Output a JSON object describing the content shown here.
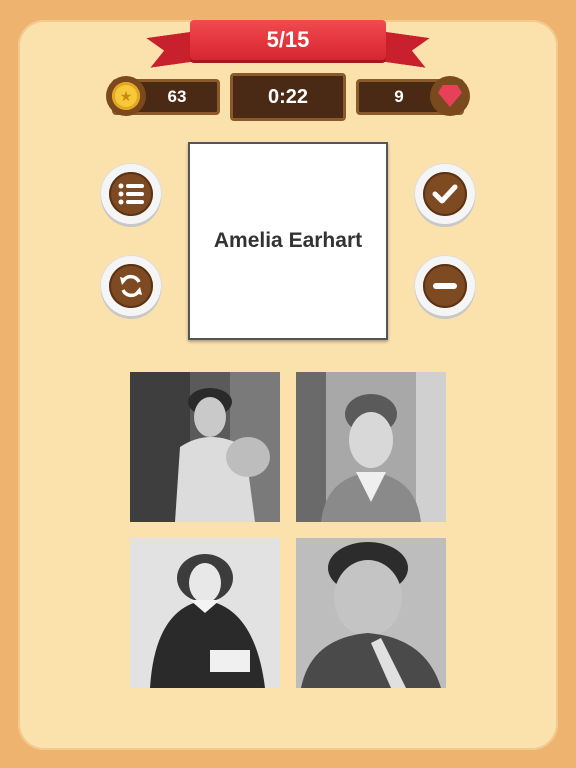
{
  "progress": {
    "label": "5/15",
    "current": 5,
    "total": 15
  },
  "stats": {
    "coins": "63",
    "timer": "0:22",
    "gems": "9"
  },
  "word_card": {
    "name": "Amelia Earhart"
  },
  "buttons": {
    "menu_icon": "list-icon",
    "restart_icon": "refresh-icon",
    "confirm_icon": "checkmark-icon",
    "skip_icon": "minus-icon"
  },
  "choices": [
    {
      "id": "photo-1",
      "kind": "portrait-woman-lace-dress"
    },
    {
      "id": "photo-2",
      "kind": "portrait-woman-aviator"
    },
    {
      "id": "photo-3",
      "kind": "portrait-woman-seated-engraving"
    },
    {
      "id": "photo-4",
      "kind": "portrait-woman-sash"
    }
  ],
  "colors": {
    "background": "#eeb36f",
    "panel": "#fbe2ad",
    "ribbon": "#d7262f",
    "wood": "#7d4a22",
    "coin": "#f6c83a",
    "gem": "#e9405a"
  }
}
